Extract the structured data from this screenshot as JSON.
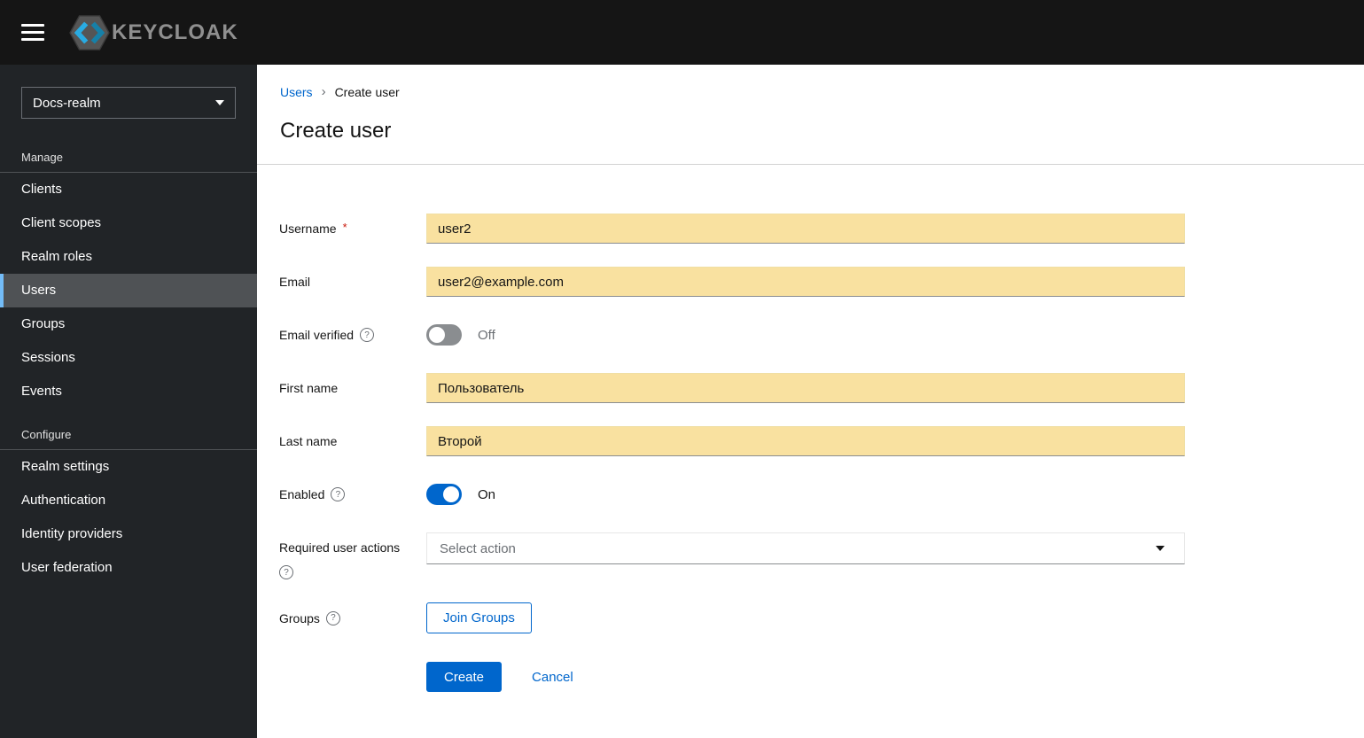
{
  "topbar": {
    "brand": "KEYCLOAK"
  },
  "sidebar": {
    "realm_selector": {
      "value": "Docs-realm"
    },
    "sections": [
      {
        "title": "Manage",
        "items": [
          {
            "label": "Clients"
          },
          {
            "label": "Client scopes"
          },
          {
            "label": "Realm roles"
          },
          {
            "label": "Users",
            "active": true
          },
          {
            "label": "Groups"
          },
          {
            "label": "Sessions"
          },
          {
            "label": "Events"
          }
        ]
      },
      {
        "title": "Configure",
        "items": [
          {
            "label": "Realm settings"
          },
          {
            "label": "Authentication"
          },
          {
            "label": "Identity providers"
          },
          {
            "label": "User federation"
          }
        ]
      }
    ]
  },
  "breadcrumb": {
    "separator": "›",
    "items": [
      {
        "label": "Users"
      },
      {
        "label": "Create user"
      }
    ]
  },
  "page": {
    "title": "Create user"
  },
  "form": {
    "username": {
      "label": "Username",
      "required_marker": "*",
      "value": "user2"
    },
    "email": {
      "label": "Email",
      "value": "user2@example.com"
    },
    "email_verified": {
      "label": "Email verified",
      "state_label": "Off"
    },
    "first_name": {
      "label": "First name",
      "value": "Пользователь"
    },
    "last_name": {
      "label": "Last name",
      "value": "Второй"
    },
    "enabled": {
      "label": "Enabled",
      "state_label": "On"
    },
    "required_user_actions": {
      "label": "Required user actions",
      "placeholder": "Select action"
    },
    "groups": {
      "label": "Groups",
      "button_label": "Join Groups"
    },
    "actions": {
      "create": "Create",
      "cancel": "Cancel"
    }
  },
  "colors": {
    "accent_blue": "#0066cc",
    "autofill_yellow": "#f9e1a0",
    "topbar_bg": "#151515",
    "sidebar_bg": "#212427",
    "active_item_bg": "#4f5255",
    "active_item_border": "#73bcf7",
    "required_red": "#c9190b"
  }
}
